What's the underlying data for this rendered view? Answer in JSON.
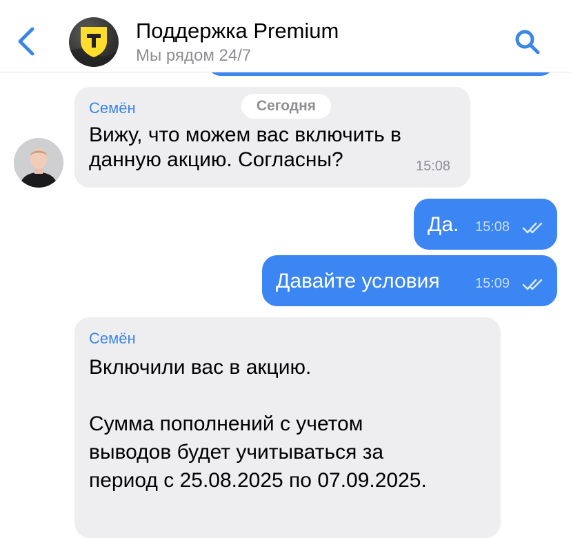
{
  "header": {
    "title": "Поддержка Premium",
    "subtitle": "Мы рядом 24/7",
    "back_icon": "chevron-left-icon",
    "search_icon": "search-icon"
  },
  "date_divider": "Сегодня",
  "messages": [
    {
      "direction": "incoming",
      "sender": "Семён",
      "text": "Вижу, что можем вас включить в\nданную акцию. Согласны?",
      "time": "15:08"
    },
    {
      "direction": "outgoing",
      "text": "Да.",
      "time": "15:08",
      "status": "read"
    },
    {
      "direction": "outgoing",
      "text": "Давайте условия",
      "time": "15:09",
      "status": "read"
    },
    {
      "direction": "incoming",
      "sender": "Семён",
      "text": "Включили вас в акцию.\n\nСумма пополнений с учетом\nвыводов будет учитываться за\nпериод с 25.08.2025 по 07.09.2025."
    }
  ],
  "colors": {
    "accent": "#3a86e6",
    "outgoing_bubble": "#3b86f2",
    "incoming_bubble": "#eeeef0",
    "logo_yellow": "#ffdd2d"
  }
}
